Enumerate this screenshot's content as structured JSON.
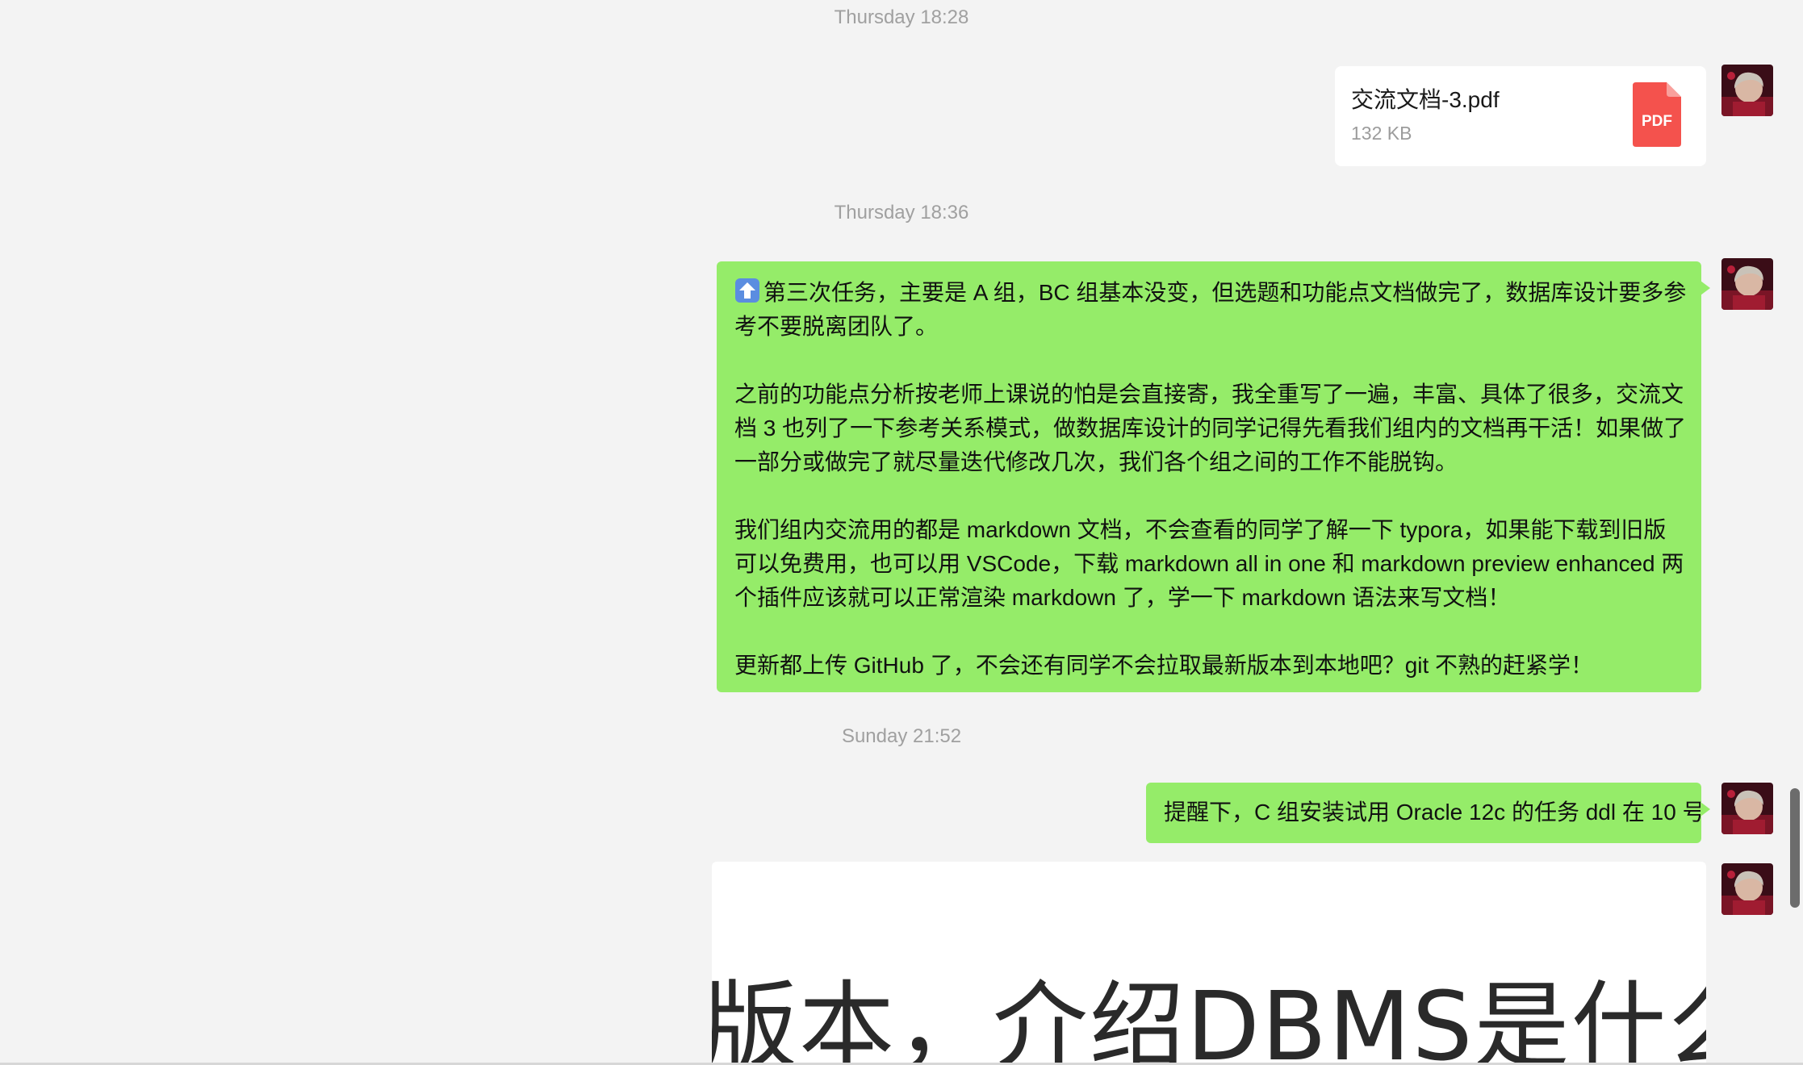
{
  "messages": {
    "ts1": "Thursday 18:28",
    "file": {
      "name": "交流文档-3.pdf",
      "size": "132 KB",
      "icon_label": "PDF",
      "icon_color": "#f4524d"
    },
    "ts2": "Thursday 18:36",
    "long_message": {
      "p1": "第三次任务，主要是 A 组，BC 组基本没变，但选题和功能点文档做完了，数据库设计要多参考不要脱离团队了。",
      "p2": "之前的功能点分析按老师上课说的怕是会直接寄，我全重写了一遍，丰富、具体了很多，交流文档 3 也列了一下参考关系模式，做数据库设计的同学记得先看我们组内的文档再干活！如果做了一部分或做完了就尽量迭代修改几次，我们各个组之间的工作不能脱钩。",
      "p3": "我们组内交流用的都是 markdown 文档，不会查看的同学了解一下 typora，如果能下载到旧版可以免费用，也可以用 VSCode，下载 markdown all in one 和 markdown preview enhanced 两个插件应该就可以正常渲染 markdown 了，学一下 markdown 语法来写文档！",
      "p4": "更新都上传 GitHub 了，不会还有同学不会拉取最新版本到本地吧？git 不熟的赶紧学！",
      "emoji_icon": "up-arrow-emoji-icon"
    },
    "ts3": "Sunday 21:52",
    "short_message": "提醒下，C 组安装试用 Oracle 12c 的任务 ddl 在 10 号",
    "image_preview_text": "版本，介绍DBMS是什么"
  },
  "colors": {
    "background": "#f3f3f3",
    "sent_bubble": "#95ec69",
    "timestamp": "#a0a0a0"
  }
}
